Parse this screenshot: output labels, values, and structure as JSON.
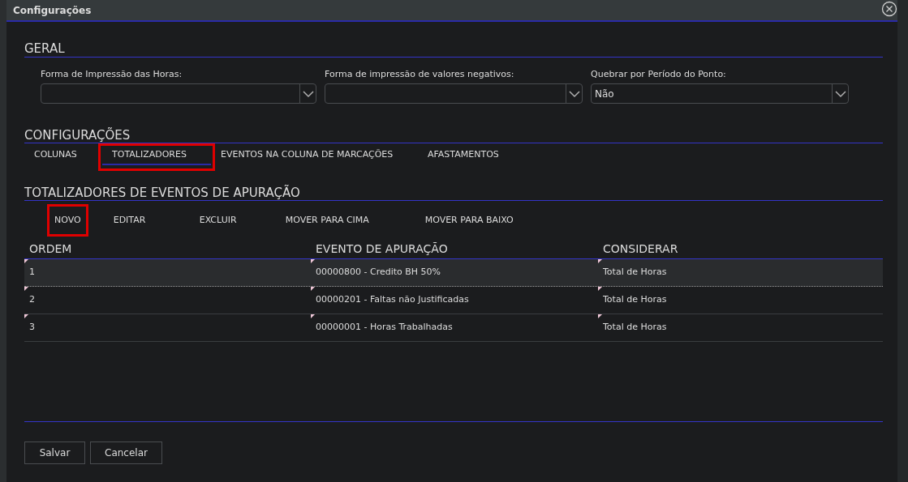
{
  "window": {
    "title": "Configurações"
  },
  "geral": {
    "title": "GERAL",
    "fields": [
      {
        "label": "Forma de Impressão das Horas:"
      },
      {
        "label": "Forma de impressão de valores negativos:"
      },
      {
        "label": "Quebrar por Período do Ponto:",
        "value": "Não"
      }
    ]
  },
  "configuracoes": {
    "title": "CONFIGURAÇÕES",
    "tabs": [
      {
        "label": "COLUNAS",
        "selected": false,
        "highlighted": false
      },
      {
        "label": "TOTALIZADORES",
        "selected": true,
        "highlighted": true
      },
      {
        "label": "EVENTOS NA COLUNA DE MARCAÇÕES",
        "selected": false,
        "highlighted": false
      },
      {
        "label": "AFASTAMENTOS",
        "selected": false,
        "highlighted": false
      }
    ]
  },
  "totalizadores": {
    "title": "TOTALIZADORES DE EVENTOS DE APURAÇÃO",
    "toolbar": [
      {
        "label": "NOVO",
        "highlighted": true
      },
      {
        "label": "EDITAR",
        "highlighted": false
      },
      {
        "label": "EXCLUIR",
        "highlighted": false
      },
      {
        "label": "MOVER PARA CIMA",
        "highlighted": false
      },
      {
        "label": "MOVER PARA BAIXO",
        "highlighted": false
      }
    ],
    "table": {
      "columns": [
        "ORDEM",
        "EVENTO DE APURAÇÃO",
        "CONSIDERAR"
      ],
      "rows": [
        {
          "cells": [
            "1",
            "00000800 - Credito BH 50%",
            "Total de Horas"
          ],
          "selected": true
        },
        {
          "cells": [
            "2",
            "00000201 - Faltas não Justificadas",
            "Total de Horas"
          ],
          "selected": false
        },
        {
          "cells": [
            "3",
            "00000001 - Horas Trabalhadas",
            "Total de Horas"
          ],
          "selected": false
        }
      ]
    }
  },
  "buttons": [
    "Salvar",
    "Cancelar"
  ]
}
